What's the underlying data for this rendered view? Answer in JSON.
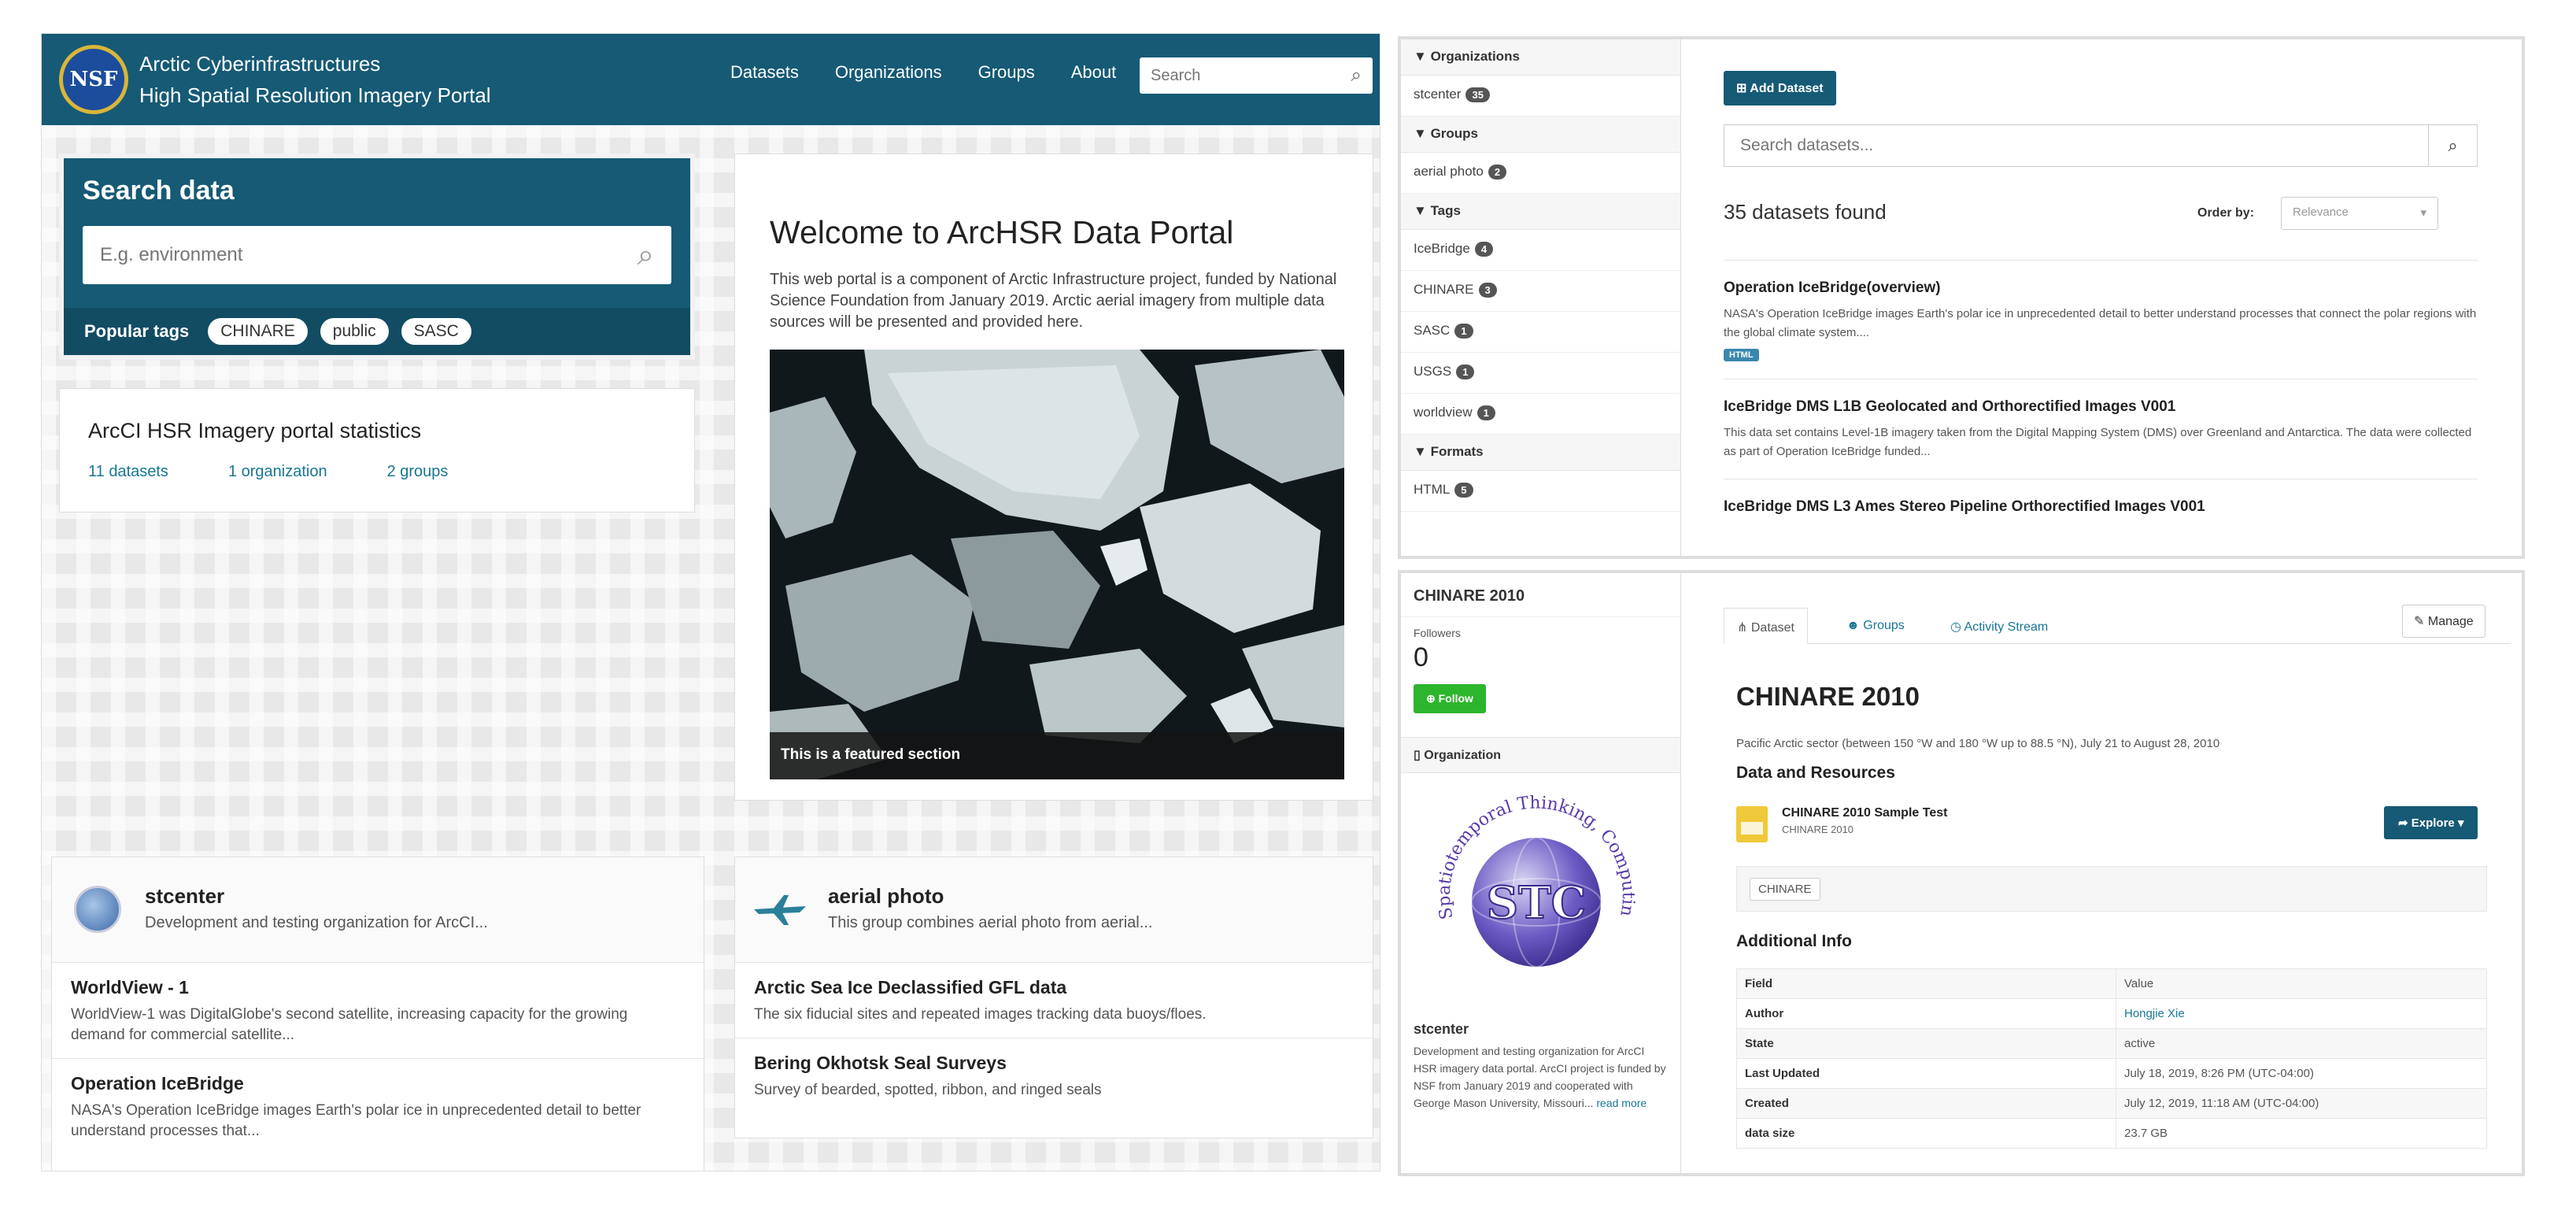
{
  "home": {
    "brand": {
      "line1": "Arctic Cyberinfrastructures",
      "line2": "High Spatial Resolution Imagery Portal",
      "logo_text": "NSF"
    },
    "nav": [
      "Datasets",
      "Organizations",
      "Groups",
      "About"
    ],
    "nav_search_placeholder": "Search",
    "search": {
      "title": "Search data",
      "placeholder": "E.g. environment",
      "popular_label": "Popular tags",
      "tags": [
        "CHINARE",
        "public",
        "SASC"
      ]
    },
    "stats": {
      "title": "ArcCI HSR Imagery portal statistics",
      "datasets": "11 datasets",
      "organizations": "1 organization",
      "groups": "2 groups"
    },
    "welcome": {
      "title": "Welcome to ArcHSR Data Portal",
      "body": "This web portal is a component of Arctic Infrastructure project, funded by National Science Foundation from January 2019. Arctic aerial imagery from multiple data sources will be presented and provided here.",
      "caption": "This is a featured section"
    },
    "org_card": {
      "title": "stcenter",
      "subtitle": "Development and testing organization for ArcCI...",
      "items": [
        {
          "title": "WorldView - 1",
          "desc": "WorldView-1 was DigitalGlobe's second satellite, increasing capacity for the growing demand for commercial satellite..."
        },
        {
          "title": "Operation IceBridge",
          "desc": "NASA's Operation IceBridge images Earth's polar ice in unprecedented detail to better understand processes that..."
        }
      ]
    },
    "group_card": {
      "title": "aerial photo",
      "subtitle": "This group combines aerial photo from aerial...",
      "items": [
        {
          "title": "Arctic Sea Ice Declassified GFL data",
          "desc": "The six fiducial sites and repeated images tracking data buoys/floes."
        },
        {
          "title": "Bering Okhotsk Seal Surveys",
          "desc": "Survey of bearded, spotted, ribbon, and ringed seals"
        }
      ]
    }
  },
  "search_page": {
    "facets": {
      "organizations": {
        "label": "Organizations",
        "items": [
          {
            "name": "stcenter",
            "count": "35"
          }
        ]
      },
      "groups": {
        "label": "Groups",
        "items": [
          {
            "name": "aerial photo",
            "count": "2"
          }
        ]
      },
      "tags": {
        "label": "Tags",
        "items": [
          {
            "name": "IceBridge",
            "count": "4"
          },
          {
            "name": "CHINARE",
            "count": "3"
          },
          {
            "name": "SASC",
            "count": "1"
          },
          {
            "name": "USGS",
            "count": "1"
          },
          {
            "name": "worldview",
            "count": "1"
          }
        ]
      },
      "formats": {
        "label": "Formats",
        "items": [
          {
            "name": "HTML",
            "count": "5"
          }
        ]
      }
    },
    "add_button": "Add Dataset",
    "search_placeholder": "Search datasets...",
    "found": "35 datasets found",
    "order_label": "Order by:",
    "order_value": "Relevance",
    "results": [
      {
        "title": "Operation IceBridge(overview)",
        "desc": "NASA's Operation IceBridge images Earth's polar ice in unprecedented detail to better understand processes that connect the polar regions with the global climate system....",
        "format": "HTML"
      },
      {
        "title": "IceBridge DMS L1B Geolocated and Orthorectified Images V001",
        "desc": "This data set contains Level-1B imagery taken from the Digital Mapping System (DMS) over Greenland and Antarctica. The data were collected as part of Operation IceBridge funded..."
      },
      {
        "title": "IceBridge DMS L3 Ames Stereo Pipeline Orthorectified Images V001",
        "desc": ""
      }
    ]
  },
  "dataset_page": {
    "name": "CHINARE 2010",
    "followers_label": "Followers",
    "followers": "0",
    "follow_button": "Follow",
    "organization_label": "Organization",
    "org_logo_text": "STC",
    "org_logo_ring": "Spatiotemporal Thinking, Computing and Applications",
    "org_name": "stcenter",
    "org_desc": "Development and testing organization for ArcCI HSR imagery data portal. ArcCI project is funded by NSF from January 2019 and cooperated with George Mason University, Missouri...",
    "read_more": "read more",
    "tabs": [
      "Dataset",
      "Groups",
      "Activity Stream"
    ],
    "manage": "Manage",
    "title": "CHINARE 2010",
    "notes": "Pacific Arctic sector (between 150 °W and 180 °W up to 88.5 °N), July 21 to August 28, 2010",
    "resources_heading": "Data and Resources",
    "resource": {
      "title": "CHINARE 2010 Sample Test",
      "subtitle": "CHINARE 2010",
      "explore": "Explore"
    },
    "tag": "CHINARE",
    "additional_heading": "Additional Info",
    "info_table": [
      {
        "field": "Field",
        "value": "Value"
      },
      {
        "field": "Author",
        "value": "Hongjie Xie"
      },
      {
        "field": "State",
        "value": "active"
      },
      {
        "field": "Last Updated",
        "value": "July 18, 2019, 8:26 PM (UTC-04:00)"
      },
      {
        "field": "Created",
        "value": "July 12, 2019, 11:18 AM (UTC-04:00)"
      },
      {
        "field": "data size",
        "value": "23.7 GB"
      }
    ]
  },
  "colors": {
    "primary": "#165a75",
    "primary_dark": "#124c63",
    "link": "#187794",
    "follow": "#2db52d",
    "format_badge": "#3a87ad"
  },
  "icons": {
    "search": "search-icon",
    "filter": "filter-icon",
    "plus": "plus-icon",
    "sitemap": "sitemap-icon",
    "users": "users-icon",
    "clock": "clock-icon",
    "wrench": "wrench-icon",
    "share": "share-icon"
  }
}
